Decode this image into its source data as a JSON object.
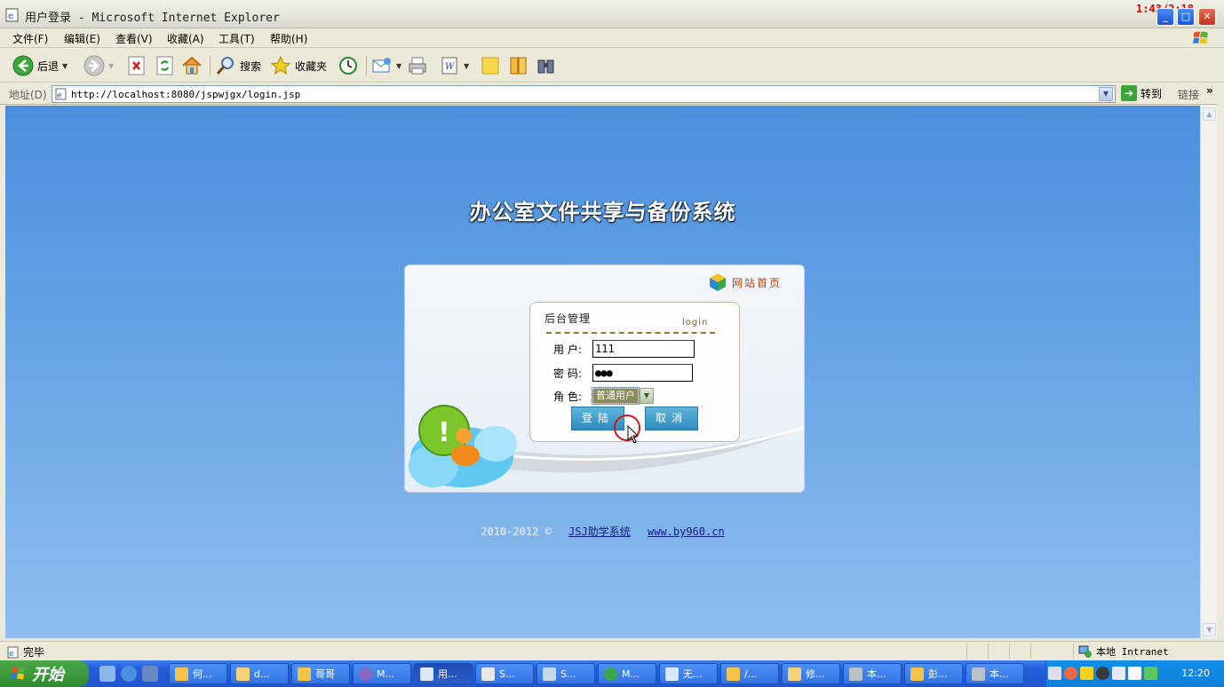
{
  "window": {
    "title": "用户登录 - Microsoft Internet Explorer",
    "timer": "1:43/2:18"
  },
  "menu": [
    "文件(F)",
    "编辑(E)",
    "查看(V)",
    "收藏(A)",
    "工具(T)",
    "帮助(H)"
  ],
  "toolbar": {
    "back": "后退",
    "search": "搜索",
    "favorites": "收藏夹"
  },
  "address": {
    "label": "地址(D)",
    "url": "http://localhost:8080/jspwjgx/login.jsp",
    "go": "转到",
    "links": "链接",
    "more": "»"
  },
  "page": {
    "title": "办公室文件共享与备份系统",
    "home_link": "网站首页",
    "login_box": {
      "heading": "后台管理",
      "heading_en": "login",
      "user_label": "用 户:",
      "user_value": "111",
      "password_label": "密 码:",
      "password_value": "●●●",
      "role_label": "角 色:",
      "role_value": "普通用户",
      "submit": "登陆",
      "cancel": "取消"
    },
    "footer": {
      "copyright": "2010-2012 ©",
      "link1": "JSJ助学系统",
      "link2": "www.by960.cn"
    }
  },
  "status": {
    "text": "完毕",
    "zone": "本地 Intranet"
  },
  "taskbar": {
    "start": "开始",
    "tasks": [
      "何...",
      "d...",
      "哥哥",
      "M...",
      "用...",
      "S...",
      "S...",
      "M...",
      "无...",
      "/...",
      "修...",
      "本...",
      "彭...",
      "本..."
    ],
    "clock": "12:20"
  }
}
